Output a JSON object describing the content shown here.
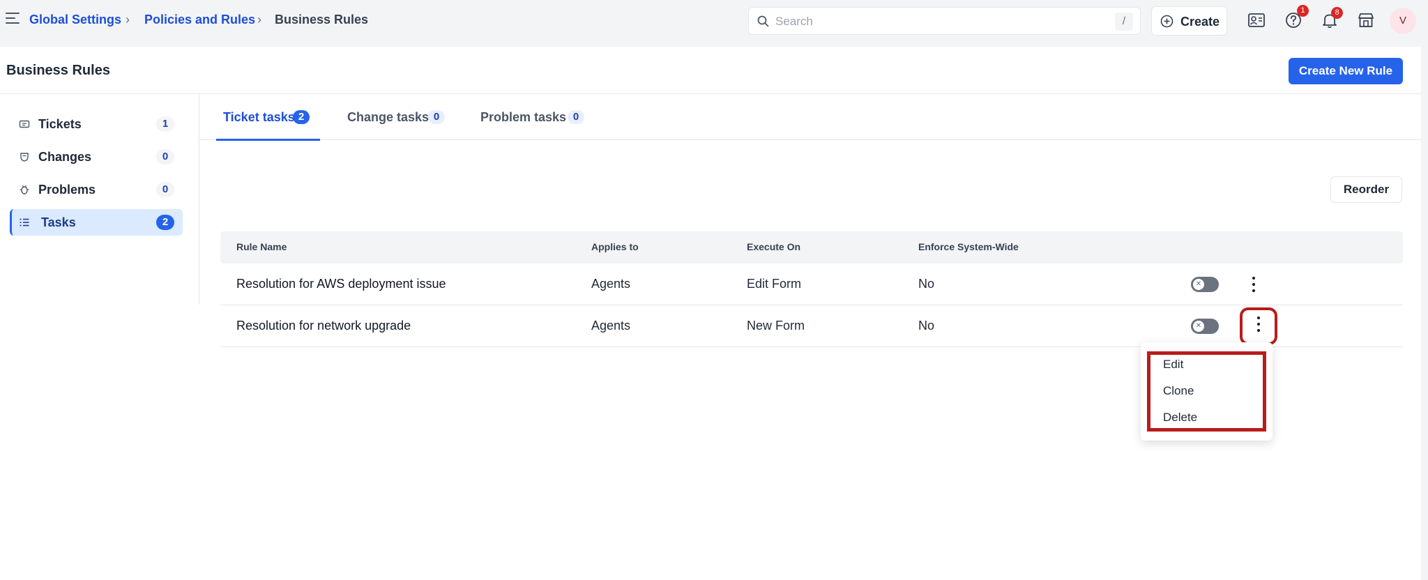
{
  "breadcrumb": {
    "items": [
      "Global Settings",
      "Policies and Rules",
      "Business Rules"
    ]
  },
  "search": {
    "placeholder": "Search",
    "shortcut": "/"
  },
  "topbar": {
    "create_label": "Create",
    "help_badge": "1",
    "notifications_badge": "8",
    "avatar_initial": "V"
  },
  "page": {
    "title": "Business Rules",
    "create_rule_label": "Create New Rule",
    "reorder_label": "Reorder"
  },
  "sidebar": {
    "items": [
      {
        "label": "Tickets",
        "count": "1",
        "icon": "ticket-icon"
      },
      {
        "label": "Changes",
        "count": "0",
        "icon": "changes-icon"
      },
      {
        "label": "Problems",
        "count": "0",
        "icon": "bug-icon"
      },
      {
        "label": "Tasks",
        "count": "2",
        "icon": "tasks-list-icon",
        "active": true
      }
    ]
  },
  "tabs": [
    {
      "label": "Ticket tasks",
      "count": "2",
      "active": true
    },
    {
      "label": "Change tasks",
      "count": "0"
    },
    {
      "label": "Problem tasks",
      "count": "0"
    }
  ],
  "table": {
    "headers": [
      "Rule Name",
      "Applies to",
      "Execute On",
      "Enforce System-Wide"
    ],
    "rows": [
      {
        "name": "Resolution for AWS deployment issue",
        "applies_to": "Agents",
        "execute_on": "Edit Form",
        "enforce": "No",
        "enabled": false
      },
      {
        "name": "Resolution for network upgrade",
        "applies_to": "Agents",
        "execute_on": "New Form",
        "enforce": "No",
        "enabled": false
      }
    ]
  },
  "context_menu": {
    "items": [
      "Edit",
      "Clone",
      "Delete"
    ]
  },
  "colors": {
    "accent": "#2563eb",
    "highlight": "#b91c1c"
  }
}
